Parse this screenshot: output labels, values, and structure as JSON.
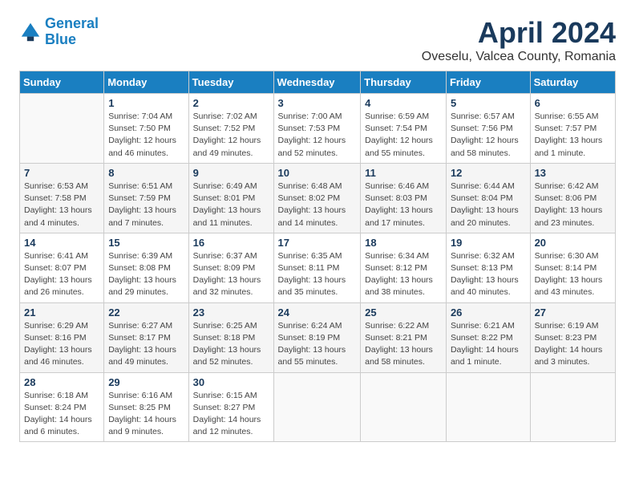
{
  "header": {
    "logo_line1": "General",
    "logo_line2": "Blue",
    "month_title": "April 2024",
    "location": "Oveselu, Valcea County, Romania"
  },
  "days_of_week": [
    "Sunday",
    "Monday",
    "Tuesday",
    "Wednesday",
    "Thursday",
    "Friday",
    "Saturday"
  ],
  "weeks": [
    [
      {
        "day": "",
        "sunrise": "",
        "sunset": "",
        "daylight": ""
      },
      {
        "day": "1",
        "sunrise": "Sunrise: 7:04 AM",
        "sunset": "Sunset: 7:50 PM",
        "daylight": "Daylight: 12 hours and 46 minutes."
      },
      {
        "day": "2",
        "sunrise": "Sunrise: 7:02 AM",
        "sunset": "Sunset: 7:52 PM",
        "daylight": "Daylight: 12 hours and 49 minutes."
      },
      {
        "day": "3",
        "sunrise": "Sunrise: 7:00 AM",
        "sunset": "Sunset: 7:53 PM",
        "daylight": "Daylight: 12 hours and 52 minutes."
      },
      {
        "day": "4",
        "sunrise": "Sunrise: 6:59 AM",
        "sunset": "Sunset: 7:54 PM",
        "daylight": "Daylight: 12 hours and 55 minutes."
      },
      {
        "day": "5",
        "sunrise": "Sunrise: 6:57 AM",
        "sunset": "Sunset: 7:56 PM",
        "daylight": "Daylight: 12 hours and 58 minutes."
      },
      {
        "day": "6",
        "sunrise": "Sunrise: 6:55 AM",
        "sunset": "Sunset: 7:57 PM",
        "daylight": "Daylight: 13 hours and 1 minute."
      }
    ],
    [
      {
        "day": "7",
        "sunrise": "Sunrise: 6:53 AM",
        "sunset": "Sunset: 7:58 PM",
        "daylight": "Daylight: 13 hours and 4 minutes."
      },
      {
        "day": "8",
        "sunrise": "Sunrise: 6:51 AM",
        "sunset": "Sunset: 7:59 PM",
        "daylight": "Daylight: 13 hours and 7 minutes."
      },
      {
        "day": "9",
        "sunrise": "Sunrise: 6:49 AM",
        "sunset": "Sunset: 8:01 PM",
        "daylight": "Daylight: 13 hours and 11 minutes."
      },
      {
        "day": "10",
        "sunrise": "Sunrise: 6:48 AM",
        "sunset": "Sunset: 8:02 PM",
        "daylight": "Daylight: 13 hours and 14 minutes."
      },
      {
        "day": "11",
        "sunrise": "Sunrise: 6:46 AM",
        "sunset": "Sunset: 8:03 PM",
        "daylight": "Daylight: 13 hours and 17 minutes."
      },
      {
        "day": "12",
        "sunrise": "Sunrise: 6:44 AM",
        "sunset": "Sunset: 8:04 PM",
        "daylight": "Daylight: 13 hours and 20 minutes."
      },
      {
        "day": "13",
        "sunrise": "Sunrise: 6:42 AM",
        "sunset": "Sunset: 8:06 PM",
        "daylight": "Daylight: 13 hours and 23 minutes."
      }
    ],
    [
      {
        "day": "14",
        "sunrise": "Sunrise: 6:41 AM",
        "sunset": "Sunset: 8:07 PM",
        "daylight": "Daylight: 13 hours and 26 minutes."
      },
      {
        "day": "15",
        "sunrise": "Sunrise: 6:39 AM",
        "sunset": "Sunset: 8:08 PM",
        "daylight": "Daylight: 13 hours and 29 minutes."
      },
      {
        "day": "16",
        "sunrise": "Sunrise: 6:37 AM",
        "sunset": "Sunset: 8:09 PM",
        "daylight": "Daylight: 13 hours and 32 minutes."
      },
      {
        "day": "17",
        "sunrise": "Sunrise: 6:35 AM",
        "sunset": "Sunset: 8:11 PM",
        "daylight": "Daylight: 13 hours and 35 minutes."
      },
      {
        "day": "18",
        "sunrise": "Sunrise: 6:34 AM",
        "sunset": "Sunset: 8:12 PM",
        "daylight": "Daylight: 13 hours and 38 minutes."
      },
      {
        "day": "19",
        "sunrise": "Sunrise: 6:32 AM",
        "sunset": "Sunset: 8:13 PM",
        "daylight": "Daylight: 13 hours and 40 minutes."
      },
      {
        "day": "20",
        "sunrise": "Sunrise: 6:30 AM",
        "sunset": "Sunset: 8:14 PM",
        "daylight": "Daylight: 13 hours and 43 minutes."
      }
    ],
    [
      {
        "day": "21",
        "sunrise": "Sunrise: 6:29 AM",
        "sunset": "Sunset: 8:16 PM",
        "daylight": "Daylight: 13 hours and 46 minutes."
      },
      {
        "day": "22",
        "sunrise": "Sunrise: 6:27 AM",
        "sunset": "Sunset: 8:17 PM",
        "daylight": "Daylight: 13 hours and 49 minutes."
      },
      {
        "day": "23",
        "sunrise": "Sunrise: 6:25 AM",
        "sunset": "Sunset: 8:18 PM",
        "daylight": "Daylight: 13 hours and 52 minutes."
      },
      {
        "day": "24",
        "sunrise": "Sunrise: 6:24 AM",
        "sunset": "Sunset: 8:19 PM",
        "daylight": "Daylight: 13 hours and 55 minutes."
      },
      {
        "day": "25",
        "sunrise": "Sunrise: 6:22 AM",
        "sunset": "Sunset: 8:21 PM",
        "daylight": "Daylight: 13 hours and 58 minutes."
      },
      {
        "day": "26",
        "sunrise": "Sunrise: 6:21 AM",
        "sunset": "Sunset: 8:22 PM",
        "daylight": "Daylight: 14 hours and 1 minute."
      },
      {
        "day": "27",
        "sunrise": "Sunrise: 6:19 AM",
        "sunset": "Sunset: 8:23 PM",
        "daylight": "Daylight: 14 hours and 3 minutes."
      }
    ],
    [
      {
        "day": "28",
        "sunrise": "Sunrise: 6:18 AM",
        "sunset": "Sunset: 8:24 PM",
        "daylight": "Daylight: 14 hours and 6 minutes."
      },
      {
        "day": "29",
        "sunrise": "Sunrise: 6:16 AM",
        "sunset": "Sunset: 8:25 PM",
        "daylight": "Daylight: 14 hours and 9 minutes."
      },
      {
        "day": "30",
        "sunrise": "Sunrise: 6:15 AM",
        "sunset": "Sunset: 8:27 PM",
        "daylight": "Daylight: 14 hours and 12 minutes."
      },
      {
        "day": "",
        "sunrise": "",
        "sunset": "",
        "daylight": ""
      },
      {
        "day": "",
        "sunrise": "",
        "sunset": "",
        "daylight": ""
      },
      {
        "day": "",
        "sunrise": "",
        "sunset": "",
        "daylight": ""
      },
      {
        "day": "",
        "sunrise": "",
        "sunset": "",
        "daylight": ""
      }
    ]
  ]
}
